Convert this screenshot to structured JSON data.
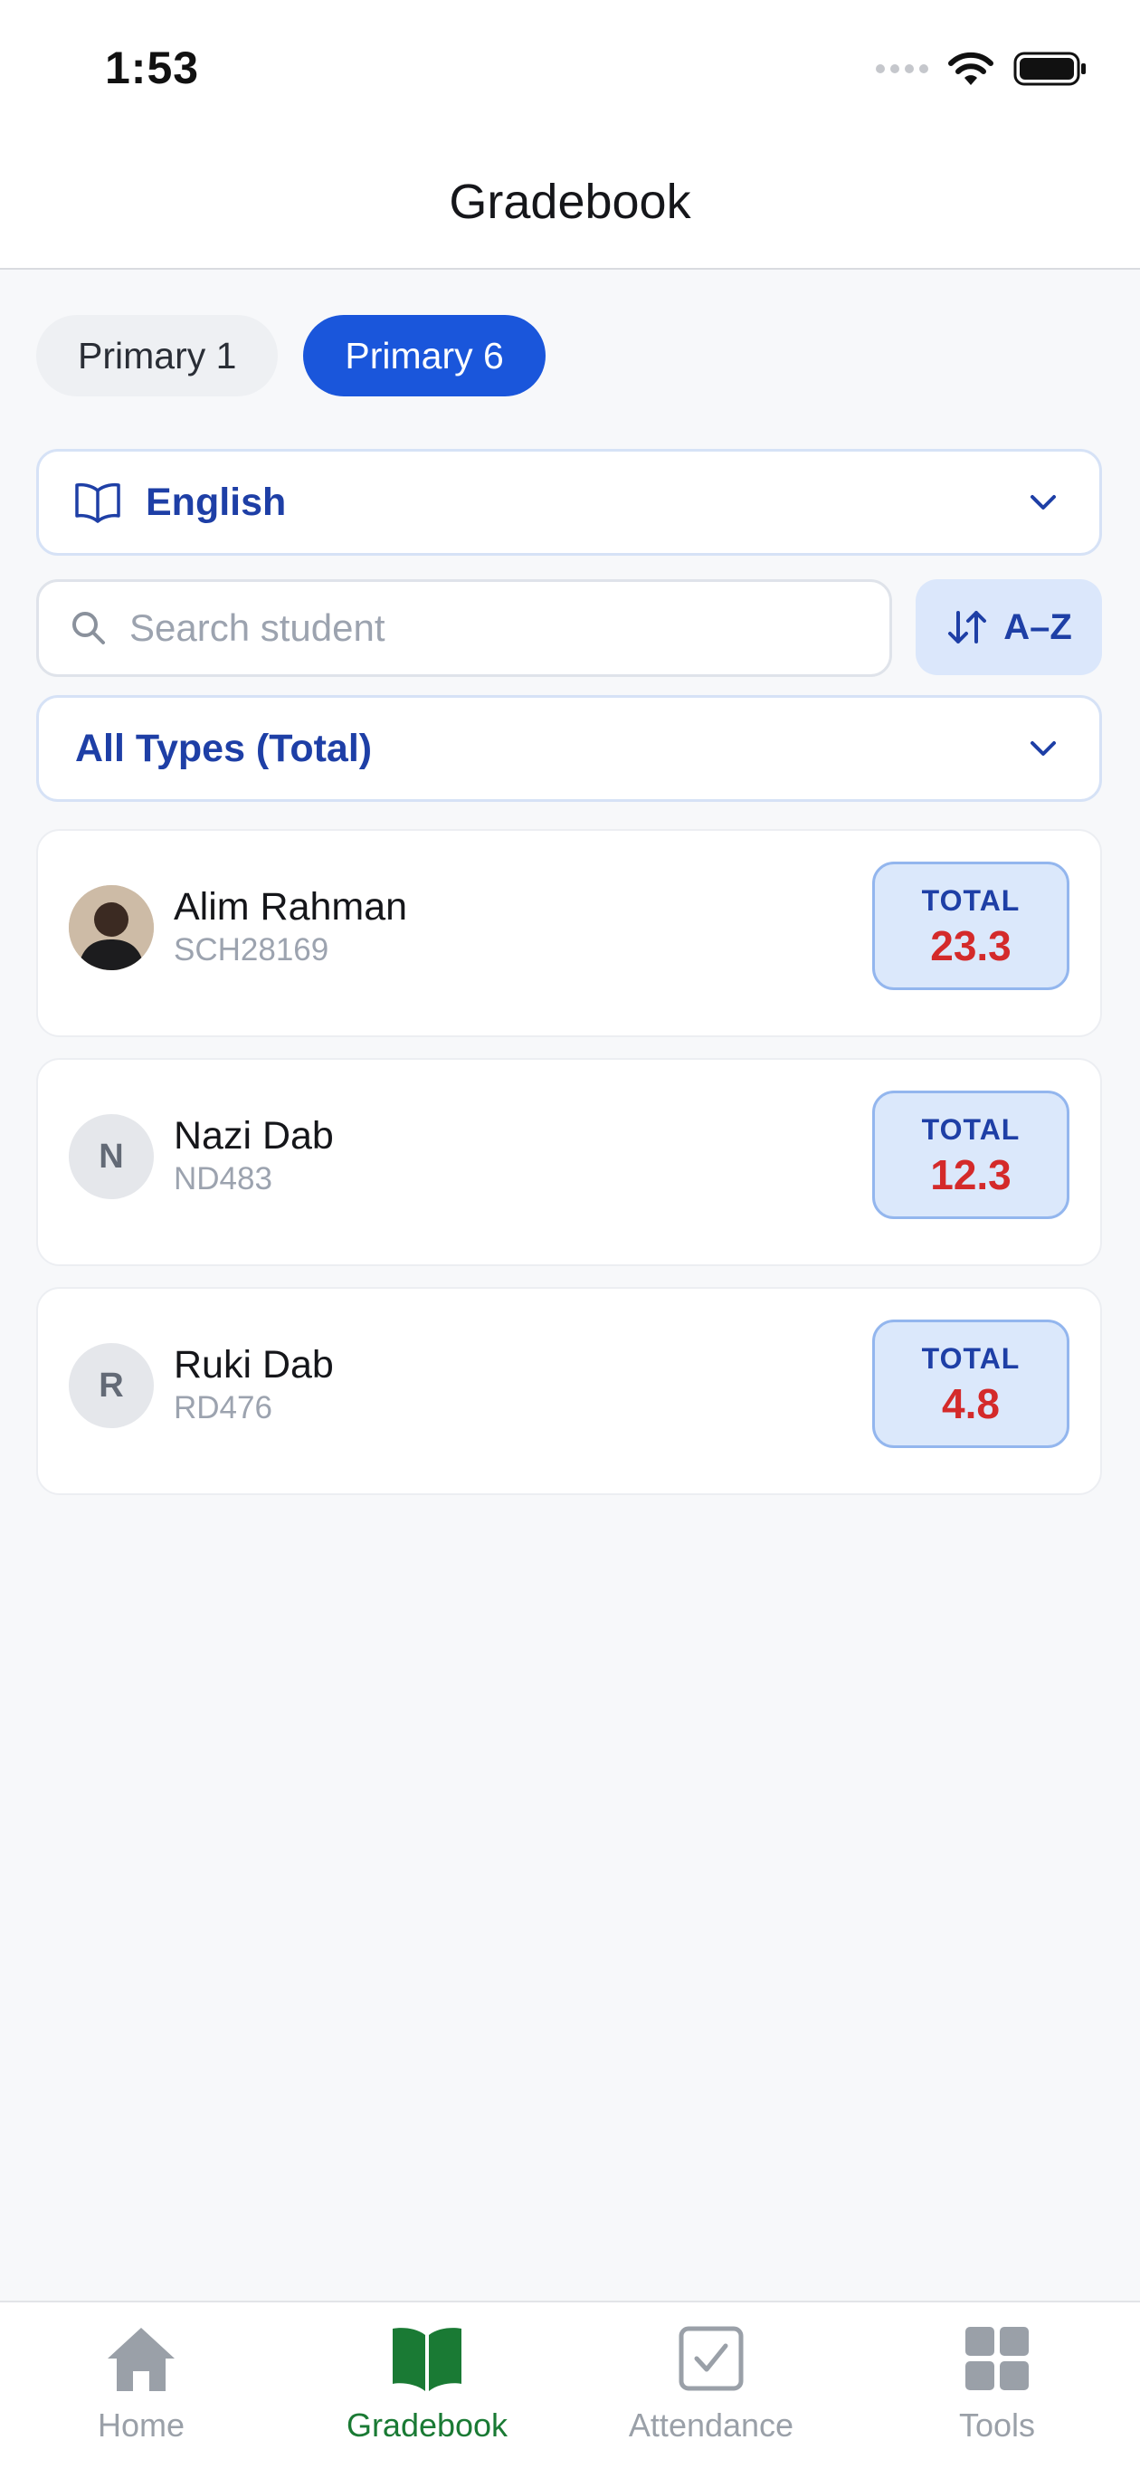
{
  "status_bar": {
    "time": "1:53"
  },
  "header": {
    "title": "Gradebook"
  },
  "class_tabs": [
    {
      "label": "Primary 1",
      "active": false
    },
    {
      "label": "Primary 6",
      "active": true
    }
  ],
  "subject": {
    "label": "English"
  },
  "search": {
    "placeholder": "Search student"
  },
  "sort": {
    "label": "A–Z"
  },
  "type_filter": {
    "label": "All Types (Total)"
  },
  "students": [
    {
      "name": "Alim Rahman",
      "id": "SCH28169",
      "initial": "",
      "total_label": "TOTAL",
      "total": "23.3",
      "has_photo": true
    },
    {
      "name": "Nazi Dab",
      "id": "ND483",
      "initial": "N",
      "total_label": "TOTAL",
      "total": "12.3",
      "has_photo": false
    },
    {
      "name": "Ruki Dab",
      "id": "RD476",
      "initial": "R",
      "total_label": "TOTAL",
      "total": "4.8",
      "has_photo": false
    }
  ],
  "bottom_nav": [
    {
      "label": "Home",
      "icon": "house-icon",
      "active": false
    },
    {
      "label": "Gradebook",
      "icon": "book-icon",
      "active": true
    },
    {
      "label": "Attendance",
      "icon": "checkbox-icon",
      "active": false
    },
    {
      "label": "Tools",
      "icon": "grid-icon",
      "active": false
    }
  ],
  "colors": {
    "accent": "#1a56db",
    "active_nav": "#1a7a34",
    "inactive_nav": "#9aa0a8",
    "total_value": "#d42a2a"
  }
}
